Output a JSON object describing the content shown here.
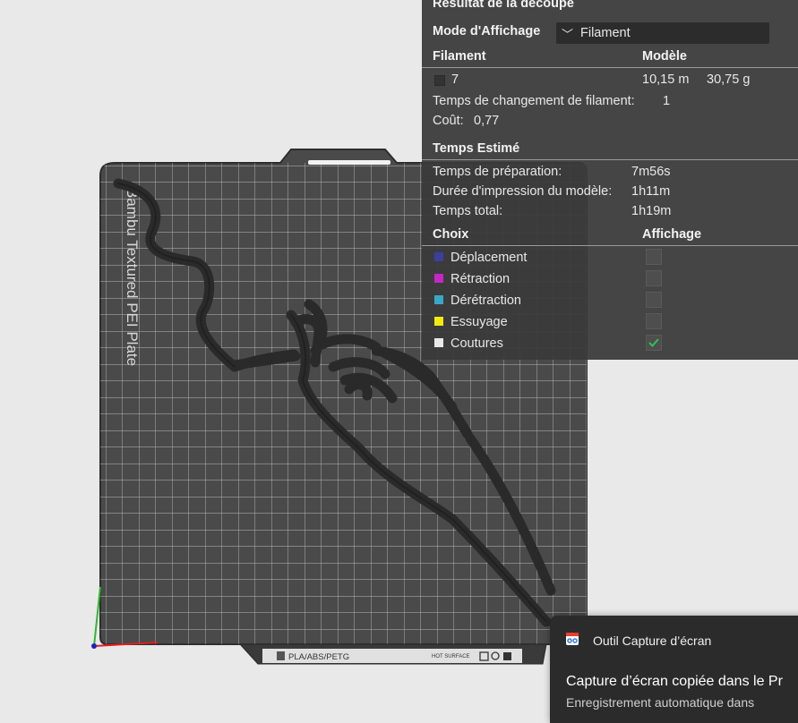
{
  "panel": {
    "title": "Résultat de la découpe",
    "view_mode_label": "Mode d'Affichage",
    "view_mode_value": "Filament",
    "table_header": {
      "filament": "Filament",
      "model": "Modèle"
    },
    "filament_row": {
      "id": "7",
      "length": "10,15 m",
      "weight": "30,75 g",
      "color": "#333333"
    },
    "filament_change_label": "Temps de changement de filament:",
    "filament_change_value": "1",
    "cost_label": "Coût:",
    "cost_value": "0,77",
    "time_section": "Temps Estimé",
    "prep_label": "Temps de préparation:",
    "prep_value": "7m56s",
    "model_print_label": "Durée d'impression du modèle:",
    "model_print_value": "1h11m",
    "total_label": "Temps total:",
    "total_value": "1h19m",
    "options_header": {
      "choice": "Choix",
      "display": "Affichage"
    },
    "options": [
      {
        "label": "Déplacement",
        "color": "#3b3fa0",
        "checked": false
      },
      {
        "label": "Rétraction",
        "color": "#c626c8",
        "checked": false
      },
      {
        "label": "Dérétraction",
        "color": "#3aa7c9",
        "checked": false
      },
      {
        "label": "Essuyage",
        "color": "#f2ea10",
        "checked": false
      },
      {
        "label": "Coutures",
        "color": "#e9e9e9",
        "checked": true
      }
    ]
  },
  "plate": {
    "brand_text": "Bambu Textured PEI Plate",
    "bottom_label": "PLA/ABS/PETG",
    "hot_surface": "HOT SURFACE"
  },
  "toast": {
    "app_name": "Outil Capture d’écran",
    "message": "Capture d’écran copiée dans le Pr",
    "sub": "Enregistrement automatique dans"
  },
  "colors": {
    "check": "#2fbf5a",
    "plate": "#4a4a4a",
    "filament": "#2a2a2a"
  }
}
